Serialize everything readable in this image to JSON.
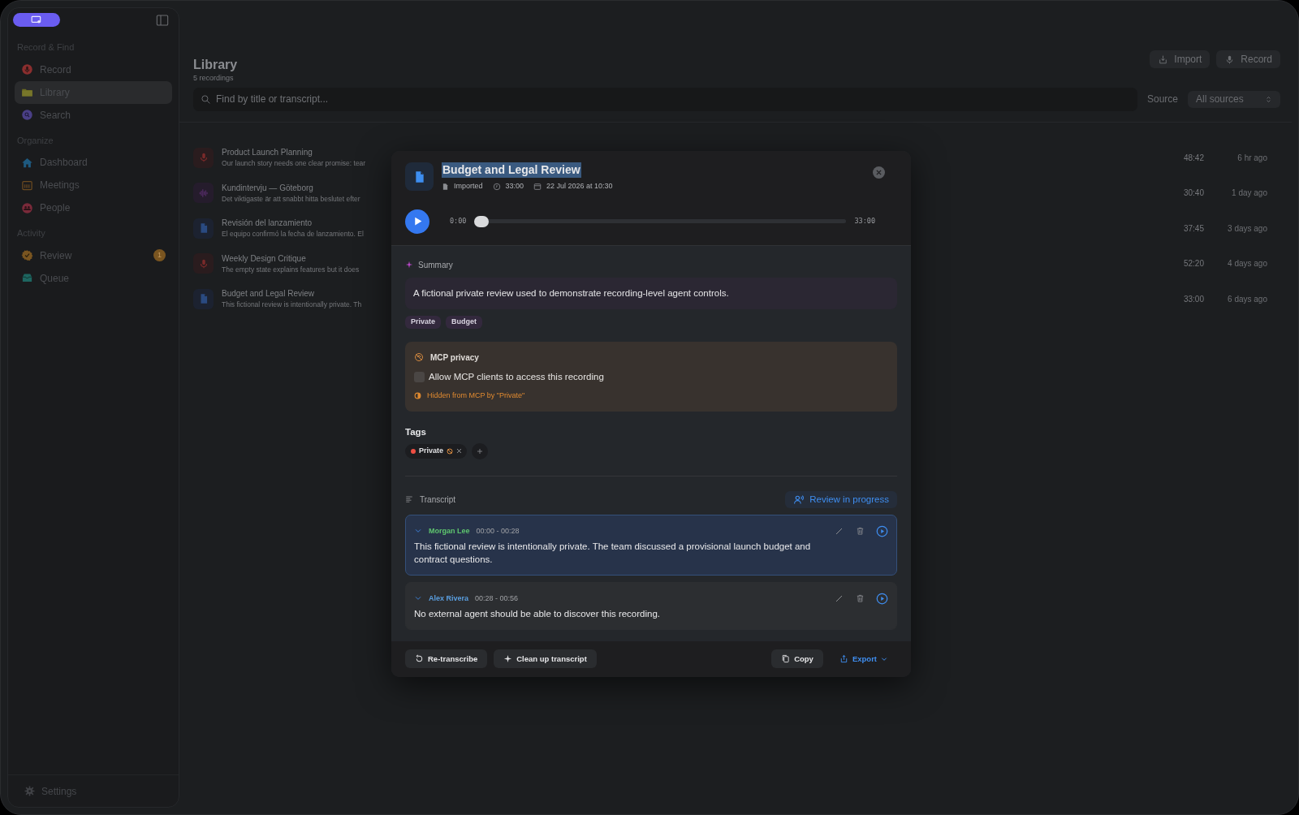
{
  "sidebar": {
    "sections": [
      {
        "title": "Record & Find",
        "items": [
          {
            "label": "Record",
            "selected": false
          },
          {
            "label": "Library",
            "selected": true
          },
          {
            "label": "Search",
            "selected": false
          }
        ]
      },
      {
        "title": "Organize",
        "items": [
          {
            "label": "Dashboard",
            "selected": false
          },
          {
            "label": "Meetings",
            "selected": false
          },
          {
            "label": "People",
            "selected": false
          }
        ]
      },
      {
        "title": "Activity",
        "items": [
          {
            "label": "Review",
            "selected": false,
            "badge": "1"
          },
          {
            "label": "Queue",
            "selected": false
          }
        ]
      }
    ],
    "settings": "Settings"
  },
  "header": {
    "title": "Library",
    "subtitle": "5 recordings",
    "buttons": [
      "Import",
      "Record"
    ],
    "search": {
      "placeholder": "Find by title or transcript..."
    },
    "filter": {
      "label": "Source",
      "value": "All sources"
    }
  },
  "recordings": [
    {
      "kind": "mic",
      "title": "Product Launch Planning",
      "snippet": "Our launch story needs one clear promise: tear",
      "duration": "48:42",
      "age": "6 hr ago"
    },
    {
      "kind": "audio",
      "title": "Kundintervju — Göteborg",
      "snippet": "Det viktigaste är att snabbt hitta beslutet efter",
      "duration": "30:40",
      "age": "1 day ago"
    },
    {
      "kind": "document",
      "title": "Revisión del lanzamiento",
      "snippet": "El equipo confirmó la fecha de lanzamiento. El",
      "duration": "37:45",
      "age": "3 days ago"
    },
    {
      "kind": "mic",
      "title": "Weekly Design Critique",
      "snippet": "The empty state explains features but it does",
      "duration": "52:20",
      "age": "4 days ago"
    },
    {
      "kind": "document",
      "title": "Budget and Legal Review",
      "snippet": "This fictional review is intentionally private. Th",
      "duration": "33:00",
      "age": "6 days ago"
    }
  ],
  "detail": {
    "title": "Budget and Legal Review",
    "title_highlighted": true,
    "source": "Imported",
    "duration": "33:00",
    "date": "22 Jul 2026 at 10:30",
    "player": {
      "current": "0:00",
      "total": "33:00",
      "level": 0
    },
    "summary": {
      "label": "Summary",
      "text": "A fictional private review used to demonstrate recording-level agent controls.",
      "tags": [
        "Private",
        "Budget"
      ]
    },
    "privacy": {
      "title": "MCP privacy",
      "checkbox": {
        "label": "Allow MCP clients to access this recording",
        "checked": false
      },
      "note": "Hidden from MCP by \"Private\""
    },
    "tags": {
      "heading": "Tags",
      "items": [
        {
          "label": "Private",
          "color": "#ef4e42"
        }
      ]
    },
    "transcript": {
      "label": "Transcript",
      "status": "Review in progress",
      "segments": [
        {
          "speaker": "Morgan Lee",
          "color": "#5ec46e",
          "range": "00:00 - 00:28",
          "text": "This fictional review is intentionally private. The team discussed a provisional launch budget and contract questions.",
          "selected": true
        },
        {
          "speaker": "Alex Rivera",
          "color": "#5a9fe0",
          "range": "00:28 - 00:56",
          "text": "No external agent should be able to discover this recording.",
          "selected": false
        }
      ]
    },
    "actions": [
      {
        "kind": "retranscribe",
        "label": "Re-transcribe"
      },
      {
        "kind": "cleanup",
        "label": "Clean up transcript"
      },
      {
        "kind": "copy",
        "label": "Copy"
      },
      {
        "kind": "export",
        "label": "Export"
      }
    ]
  }
}
